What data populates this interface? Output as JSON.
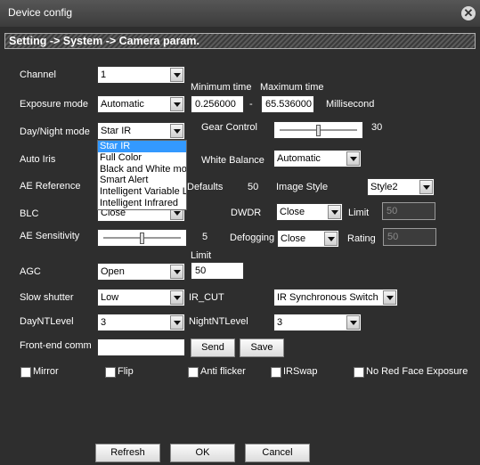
{
  "window": {
    "title": "Device config"
  },
  "breadcrumb": "Setting -> System -> Camera param.",
  "channel": {
    "label": "Channel",
    "value": "1"
  },
  "exposure": {
    "label": "Exposure mode",
    "value": "Automatic",
    "min_label": "Minimum time",
    "max_label": "Maximum time",
    "min_value": "0.256000",
    "dash": "-",
    "max_value": "65.536000",
    "unit": "Millisecond"
  },
  "day_night": {
    "label": "Day/Night mode",
    "value": "Star IR",
    "options": [
      "Star IR",
      "Full Color",
      "Black and White mode",
      "Smart Alert",
      "Intelligent Variable Light",
      "Intelligent Infrared"
    ],
    "highlighted_index": 0
  },
  "gear_control": {
    "label": "Gear Control",
    "value": "30"
  },
  "auto_iris": {
    "label": "Auto Iris"
  },
  "white_balance": {
    "label": "White Balance",
    "value": "Automatic"
  },
  "ae_reference": {
    "label": "AE Reference",
    "defaults_label": "Defaults",
    "defaults_value": "50"
  },
  "image_style": {
    "label": "Image Style",
    "value": "Style2"
  },
  "blc": {
    "label": "BLC",
    "value": "Close"
  },
  "dwdr": {
    "label": "DWDR",
    "value": "Close",
    "limit_label": "Limit",
    "limit_value": "50"
  },
  "ae_sensitivity": {
    "label": "AE Sensitivity",
    "value": "5"
  },
  "defogging": {
    "label": "Defogging",
    "value": "Close",
    "rating_label": "Rating",
    "rating_value": "50"
  },
  "agc": {
    "label": "AGC",
    "value": "Open",
    "limit_label": "Limit",
    "limit_value": "50"
  },
  "slow_shutter": {
    "label": "Slow shutter",
    "value": "Low"
  },
  "ir_cut": {
    "label": "IR_CUT",
    "value": "IR Synchronous Switch"
  },
  "day_nt_level": {
    "label": "DayNTLevel",
    "value": "3"
  },
  "night_nt_level": {
    "label": "NightNTLevel",
    "value": "3"
  },
  "front_end": {
    "label": "Front-end comm",
    "value": "",
    "send_label": "Send",
    "save_label": "Save"
  },
  "checkboxes": {
    "mirror": "Mirror",
    "flip": "Flip",
    "anti_flicker": "Anti flicker",
    "irswap": "IRSwap",
    "no_red_face": "No Red Face Exposure"
  },
  "footer": {
    "refresh": "Refresh",
    "ok": "OK",
    "cancel": "Cancel"
  },
  "colors": {
    "background": "#2e2e2e",
    "highlight": "#3399ff"
  }
}
